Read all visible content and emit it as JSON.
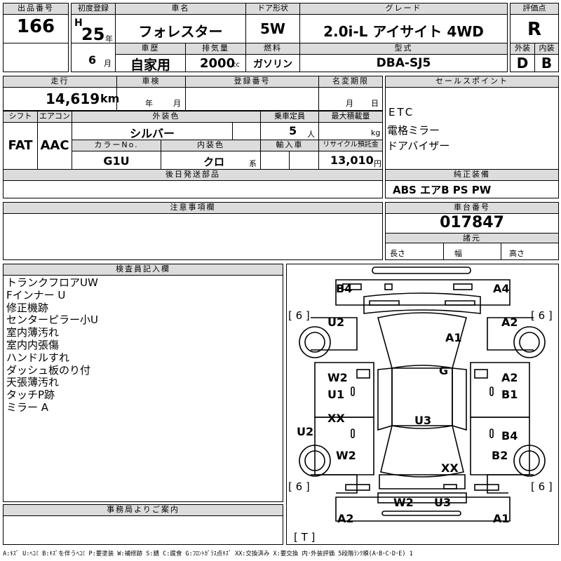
{
  "labels": {
    "lot_no": "出品番号",
    "first_reg": "初度登録",
    "car_name": "車名",
    "door": "ドア形状",
    "grade": "グレード",
    "score": "評価点",
    "history": "車歴",
    "displacement": "排気量",
    "fuel": "燃料",
    "model_code": "型式",
    "exterior": "外装",
    "interior": "内装",
    "mileage": "走行",
    "inspection": "車検",
    "reg_no": "登録番号",
    "name_change": "名変期限",
    "sales_point": "セールスポイント",
    "shift": "シフト",
    "aircon": "エアコン",
    "ext_color": "外装色",
    "capacity": "乗車定員",
    "max_load": "最大積載量",
    "color_no": "カラーNo.",
    "int_color": "内装色",
    "import": "輸入車",
    "recycle": "リサイクル預託金",
    "later_parts": "後日発送部品",
    "genuine_equip": "純正装備",
    "notes": "注意事項欄",
    "chassis_no": "車台番号",
    "specs": "諸元",
    "length": "長さ",
    "width": "幅",
    "height": "高さ",
    "inspector": "検査員記入欄",
    "office": "事務局よりご案内",
    "year_unit": "年",
    "month_unit": "月",
    "cc_unit": "cc",
    "km_unit": "km",
    "person_unit": "人",
    "kg_unit": "kg",
    "yen_unit": "円",
    "kei_unit": "系",
    "era": "H"
  },
  "values": {
    "lot_no": "166",
    "year": "25",
    "month": "6",
    "car_name": "フォレスター",
    "door": "5W",
    "grade": "2.0i-L アイサイト 4WD",
    "score": "R",
    "history": "自家用",
    "displacement": "2000",
    "fuel": "ガソリン",
    "model_code": "DBA-SJ5",
    "exterior": "D",
    "interior": "B",
    "mileage": "14,619",
    "shift": "FAT",
    "aircon": "AAC",
    "ext_color": "シルバー",
    "capacity": "5",
    "color_no": "G1U",
    "int_color": "クロ",
    "recycle": "13,010",
    "sales_points": [
      "ETC",
      "電格ミラー",
      "ドアバイザー"
    ],
    "genuine_equip": "ABS エアB PS PW",
    "chassis_no": "017847",
    "inspector_notes": [
      "トランクフロアUW",
      "Fインナー U",
      "修正機跡",
      "センターピラー小U",
      "室内薄汚れ",
      "室内内張傷",
      "ハンドルすれ",
      "ダッシュ板のり付",
      "天張薄汚れ",
      "タッチP跡",
      "ミラー A"
    ]
  },
  "diagram_marks": {
    "b4": "B4",
    "a4": "A4",
    "u2_top": "U2",
    "a2_top": "A2",
    "a1_top": "A1",
    "g": "G",
    "w2_left": "W2",
    "u1": "U1",
    "a2_right": "A2",
    "b1": "B1",
    "xx_left": "XX",
    "u3_center": "U3",
    "b4_right": "B4",
    "u2_left": "U2",
    "w2_left2": "W2",
    "b2": "B2",
    "xx_center": "XX",
    "w2_rear": "W2",
    "u3_rear": "U3",
    "a2_bottom": "A2",
    "a1_bottom": "A1",
    "tire_tl": "[ 6 ]",
    "tire_tr": "[ 6 ]",
    "tire_bl": "[ 6 ]",
    "tire_br": "[ 6 ]",
    "spare": "[ T ]"
  },
  "legend": "A:ｷｽﾞ U:ﾍｺﾐ B:ｷｽﾞを伴うﾍｺﾐ P:要塗装 W:補修跡 S:錆 C:腐食 G:ﾌﾛﾝﾄｶﾞﾗｽ点ｷｽﾞ XX:交換済み X:要交換 内･外装評価 5段階ﾗﾝｸ順(A･B･C･D･E) 1"
}
